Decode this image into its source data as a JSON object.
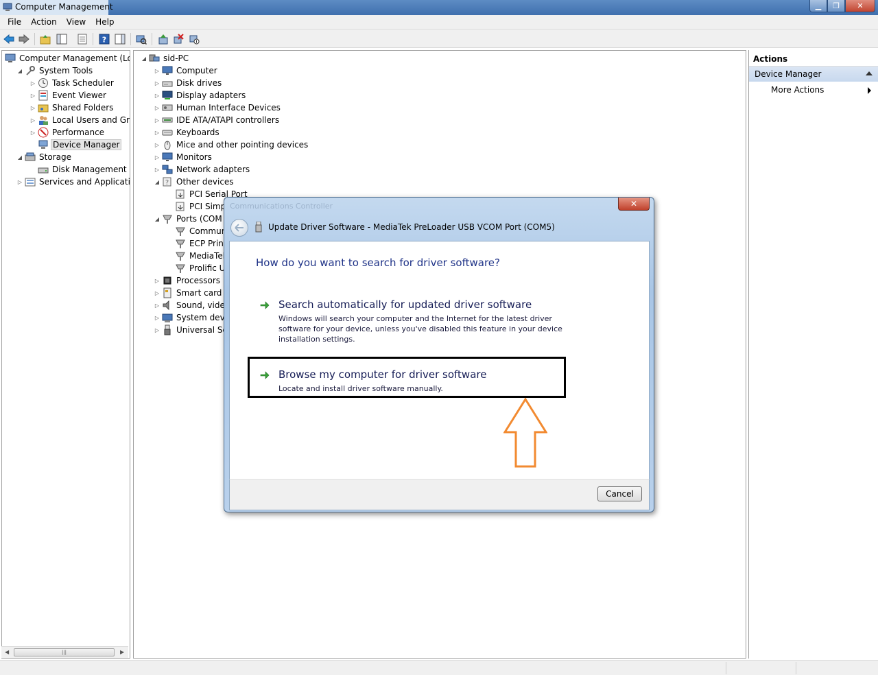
{
  "window": {
    "title": "Computer Management"
  },
  "menubar": {
    "items": [
      "File",
      "Action",
      "View",
      "Help"
    ]
  },
  "left_tree": {
    "items": [
      {
        "label": "Computer Management (Local",
        "icon": "computer-management-icon",
        "level": 0,
        "expander": ""
      },
      {
        "label": "System Tools",
        "icon": "system-tools-icon",
        "level": 1,
        "expander": "open"
      },
      {
        "label": "Task Scheduler",
        "icon": "clock-icon",
        "level": 2,
        "expander": "closed"
      },
      {
        "label": "Event Viewer",
        "icon": "event-viewer-icon",
        "level": 2,
        "expander": "closed"
      },
      {
        "label": "Shared Folders",
        "icon": "shared-folder-icon",
        "level": 2,
        "expander": "closed"
      },
      {
        "label": "Local Users and Groups",
        "icon": "users-icon",
        "level": 2,
        "expander": "closed"
      },
      {
        "label": "Performance",
        "icon": "performance-icon",
        "level": 2,
        "expander": "closed"
      },
      {
        "label": "Device Manager",
        "icon": "device-manager-icon",
        "level": 2,
        "expander": "",
        "selected": true
      },
      {
        "label": "Storage",
        "icon": "storage-icon",
        "level": 1,
        "expander": "open"
      },
      {
        "label": "Disk Management",
        "icon": "disk-icon",
        "level": 2,
        "expander": ""
      },
      {
        "label": "Services and Applications",
        "icon": "services-icon",
        "level": 1,
        "expander": "closed"
      }
    ]
  },
  "device_tree": {
    "root": "sid-PC",
    "items": [
      {
        "label": "Computer",
        "icon": "monitor-icon",
        "level": 1,
        "expander": "closed"
      },
      {
        "label": "Disk drives",
        "icon": "disk-drive-icon",
        "level": 1,
        "expander": "closed"
      },
      {
        "label": "Display adapters",
        "icon": "display-adapter-icon",
        "level": 1,
        "expander": "closed"
      },
      {
        "label": "Human Interface Devices",
        "icon": "hid-icon",
        "level": 1,
        "expander": "closed"
      },
      {
        "label": "IDE ATA/ATAPI controllers",
        "icon": "ide-icon",
        "level": 1,
        "expander": "closed"
      },
      {
        "label": "Keyboards",
        "icon": "keyboard-icon",
        "level": 1,
        "expander": "closed"
      },
      {
        "label": "Mice and other pointing devices",
        "icon": "mouse-icon",
        "level": 1,
        "expander": "closed"
      },
      {
        "label": "Monitors",
        "icon": "monitor-icon",
        "level": 1,
        "expander": "closed"
      },
      {
        "label": "Network adapters",
        "icon": "network-icon",
        "level": 1,
        "expander": "closed"
      },
      {
        "label": "Other devices",
        "icon": "other-devices-icon",
        "level": 1,
        "expander": "open"
      },
      {
        "label": "PCI Serial Port",
        "icon": "unknown-device-icon",
        "level": 2,
        "expander": ""
      },
      {
        "label": "PCI Simpl",
        "icon": "unknown-device-icon",
        "level": 2,
        "expander": ""
      },
      {
        "label": "Ports (COM &",
        "icon": "port-icon",
        "level": 1,
        "expander": "open"
      },
      {
        "label": "Commun",
        "icon": "port-icon",
        "level": 2,
        "expander": ""
      },
      {
        "label": "ECP Print",
        "icon": "port-icon",
        "level": 2,
        "expander": ""
      },
      {
        "label": "MediaTek",
        "icon": "port-icon",
        "level": 2,
        "expander": ""
      },
      {
        "label": "Prolific US",
        "icon": "port-icon",
        "level": 2,
        "expander": ""
      },
      {
        "label": "Processors",
        "icon": "processor-icon",
        "level": 1,
        "expander": "closed"
      },
      {
        "label": "Smart card re",
        "icon": "smart-card-icon",
        "level": 1,
        "expander": "closed"
      },
      {
        "label": "Sound, video",
        "icon": "sound-icon",
        "level": 1,
        "expander": "closed"
      },
      {
        "label": "System devic",
        "icon": "system-device-icon",
        "level": 1,
        "expander": "closed"
      },
      {
        "label": "Universal Seri",
        "icon": "usb-icon",
        "level": 1,
        "expander": "closed"
      }
    ]
  },
  "actions_pane": {
    "header": "Actions",
    "section": "Device Manager",
    "more_actions": "More Actions"
  },
  "dialog": {
    "ghost_title": "Communications Controller",
    "nav_title": "Update Driver Software - MediaTek PreLoader USB VCOM Port (COM5)",
    "heading": "How do you want to search for driver software?",
    "option1_title": "Search automatically for updated driver software",
    "option1_desc": "Windows will search your computer and the Internet for the latest driver software for your device, unless you've disabled this feature in your device installation settings.",
    "option2_title": "Browse my computer for driver software",
    "option2_desc": "Locate and install driver software manually.",
    "cancel_label": "Cancel",
    "close_glyph": "✕"
  },
  "colors": {
    "heading_blue": "#1e3287",
    "highlight_border": "#000000",
    "annotation_arrow": "#f28a30",
    "option_arrow_green": "#3aa23a"
  }
}
